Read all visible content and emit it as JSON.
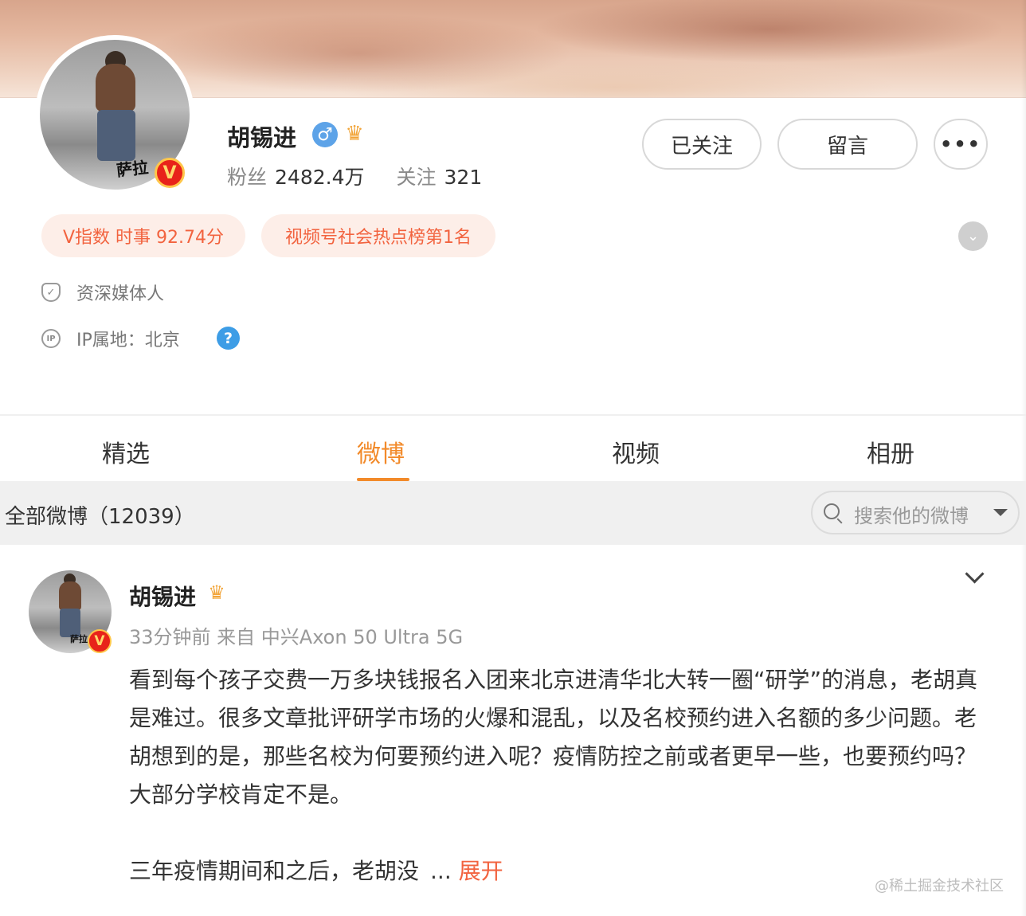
{
  "profile": {
    "name": "胡锡进",
    "fans_label": "粉丝",
    "fans_value": "2482.4万",
    "following_label": "关注",
    "following_value": "321",
    "gender_icon": "male-icon",
    "avatar_sign": "萨拉"
  },
  "actions": {
    "follow": "已关注",
    "message": "留言",
    "more": "•••"
  },
  "tags": {
    "v_index": "V指数 时事 92.74分",
    "hot_rank": "视频号社会热点榜第1名"
  },
  "info": {
    "role": "资深媒体人",
    "ip": "IP属地：北京"
  },
  "tabs": {
    "jingxuan": "精选",
    "weibo": "微博",
    "video": "视频",
    "album": "相册",
    "active": "微博"
  },
  "filter": {
    "title": "全部微博（12039）",
    "search_placeholder": "搜索他的微博"
  },
  "post": {
    "author": "胡锡进",
    "meta": "33分钟前 来自 中兴Axon 50 Ultra 5G",
    "paragraph1": "看到每个孩子交费一万多块钱报名入团来北京进清华北大转一圈“研学”的消息，老胡真是难过。很多文章批评研学市场的火爆和混乱，以及名校预约进入名额的多少问题。老胡想到的是，那些名校为何要预约进入呢？疫情防控之前或者更早一些，也要预约吗？大部分学校肯定不是。",
    "paragraph2": "三年疫情期间和之后，老胡没",
    "ellipsis": "...",
    "expand": "展开"
  },
  "watermark": "@稀土掘金技术社区",
  "colors": {
    "accent": "#f28a2a",
    "tag_text": "#f2633f",
    "tag_bg": "#fdeee8",
    "verified_red": "#e8231a",
    "help_blue": "#3d9de6"
  }
}
